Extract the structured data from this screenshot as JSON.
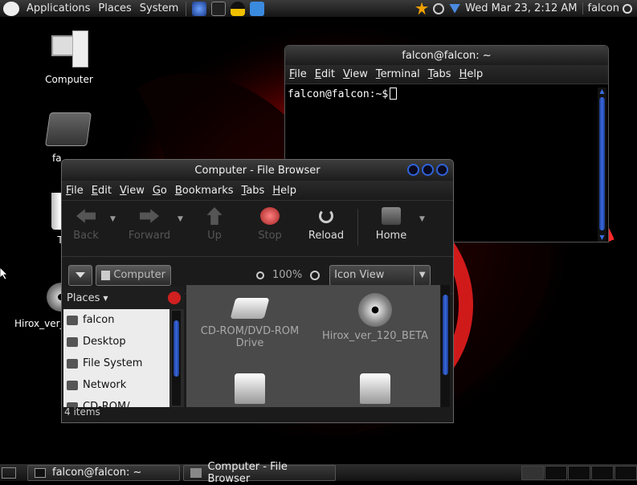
{
  "top_panel": {
    "menus": [
      "Applications",
      "Places",
      "System"
    ],
    "clock": "Wed Mar 23,  2:12 AM",
    "user": "falcon"
  },
  "desktop_icons": [
    {
      "label": "Computer"
    },
    {
      "label": "fa"
    },
    {
      "label": "T"
    },
    {
      "label": "Hirox_ver_"
    }
  ],
  "terminal": {
    "title": "falcon@falcon: ~",
    "menus": [
      "File",
      "Edit",
      "View",
      "Terminal",
      "Tabs",
      "Help"
    ],
    "prompt": "falcon@falcon:~$"
  },
  "file_browser": {
    "title": "Computer - File Browser",
    "menus": [
      "File",
      "Edit",
      "View",
      "Go",
      "Bookmarks",
      "Tabs",
      "Help"
    ],
    "toolbar": {
      "back": "Back",
      "forward": "Forward",
      "up": "Up",
      "stop": "Stop",
      "reload": "Reload",
      "home": "Home"
    },
    "location_button": "Computer",
    "zoom": "100%",
    "view_mode": "Icon View",
    "sidebar": {
      "header": "Places",
      "items": [
        "falcon",
        "Desktop",
        "File System",
        "Network",
        "CD-ROM/..."
      ]
    },
    "items": [
      {
        "label": "CD-ROM/DVD-ROM",
        "label2": "Drive"
      },
      {
        "label": "Hirox_ver_120_BETA"
      },
      {
        "label": ""
      },
      {
        "label": ""
      }
    ],
    "status": "4 items"
  },
  "taskbar": {
    "tasks": [
      "falcon@falcon: ~",
      "Computer - File Browser"
    ]
  },
  "colors": {
    "accent_blue": "#2f62d8",
    "wallpaper_red": "#d40000"
  }
}
